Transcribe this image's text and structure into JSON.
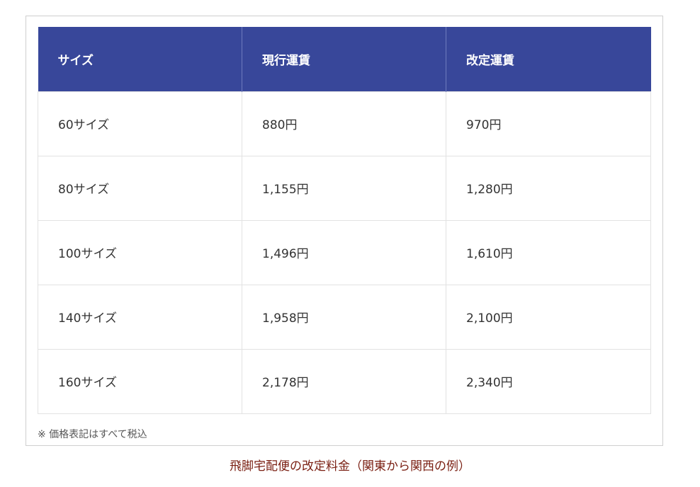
{
  "table": {
    "headers": [
      "サイズ",
      "現行運賃",
      "改定運賃"
    ],
    "rows": [
      [
        "60サイズ",
        "880円",
        "970円"
      ],
      [
        "80サイズ",
        "1,155円",
        "1,280円"
      ],
      [
        "100サイズ",
        "1,496円",
        "1,610円"
      ],
      [
        "140サイズ",
        "1,958円",
        "2,100円"
      ],
      [
        "160サイズ",
        "2,178円",
        "2,340円"
      ]
    ]
  },
  "note": "※ 価格表記はすべて税込",
  "caption": "飛脚宅配便の改定料金（関東から関西の例）",
  "colors": {
    "header_bg": "#38479a",
    "header_text": "#ffffff",
    "caption_text": "#7a1f12"
  }
}
